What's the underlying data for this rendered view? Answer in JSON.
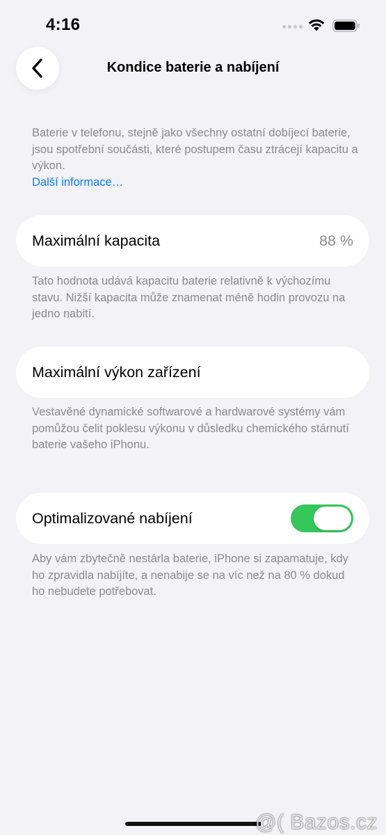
{
  "status_bar": {
    "time": "4:16",
    "icons": [
      "signal-icon",
      "wifi-icon",
      "battery-icon"
    ]
  },
  "nav": {
    "title": "Kondice baterie a nabíjení",
    "back_icon": "chevron-left-icon"
  },
  "intro": {
    "text": "Baterie v telefonu, stejně jako všechny ostatní dobíjecí baterie, jsou spotřební součásti, které postupem času ztrácejí kapacitu a výkon.",
    "link": "Další informace…"
  },
  "max_capacity": {
    "label": "Maximální kapacita",
    "value": "88 %",
    "footnote": "Tato hodnota udává kapacitu baterie relativně k výchozímu stavu. Nižší kapacita může znamenat méně hodin provozu na jedno nabití."
  },
  "peak_performance": {
    "label": "Maximální výkon zařízení",
    "footnote": "Vestavěné dynamické softwarové a hardwarové systémy vám pomůžou čelit poklesu výkonu v důsledku chemického stárnutí baterie vašeho iPhonu."
  },
  "optimized_charging": {
    "label": "Optimalizované nabíjení",
    "enabled": true,
    "footnote": "Aby vám zbytečně nestárla baterie, iPhone si zapamatuje, kdy ho zpravidla nabíjíte, a nenabije se na víc než na 80 % dokud ho nebudete potřebovat."
  },
  "watermark": "@( Bazos.cz",
  "colors": {
    "background": "#f2f2f7",
    "card": "#ffffff",
    "link": "#0a7aff",
    "toggle_on": "#34c759",
    "secondary_text": "#8a8a8e"
  }
}
